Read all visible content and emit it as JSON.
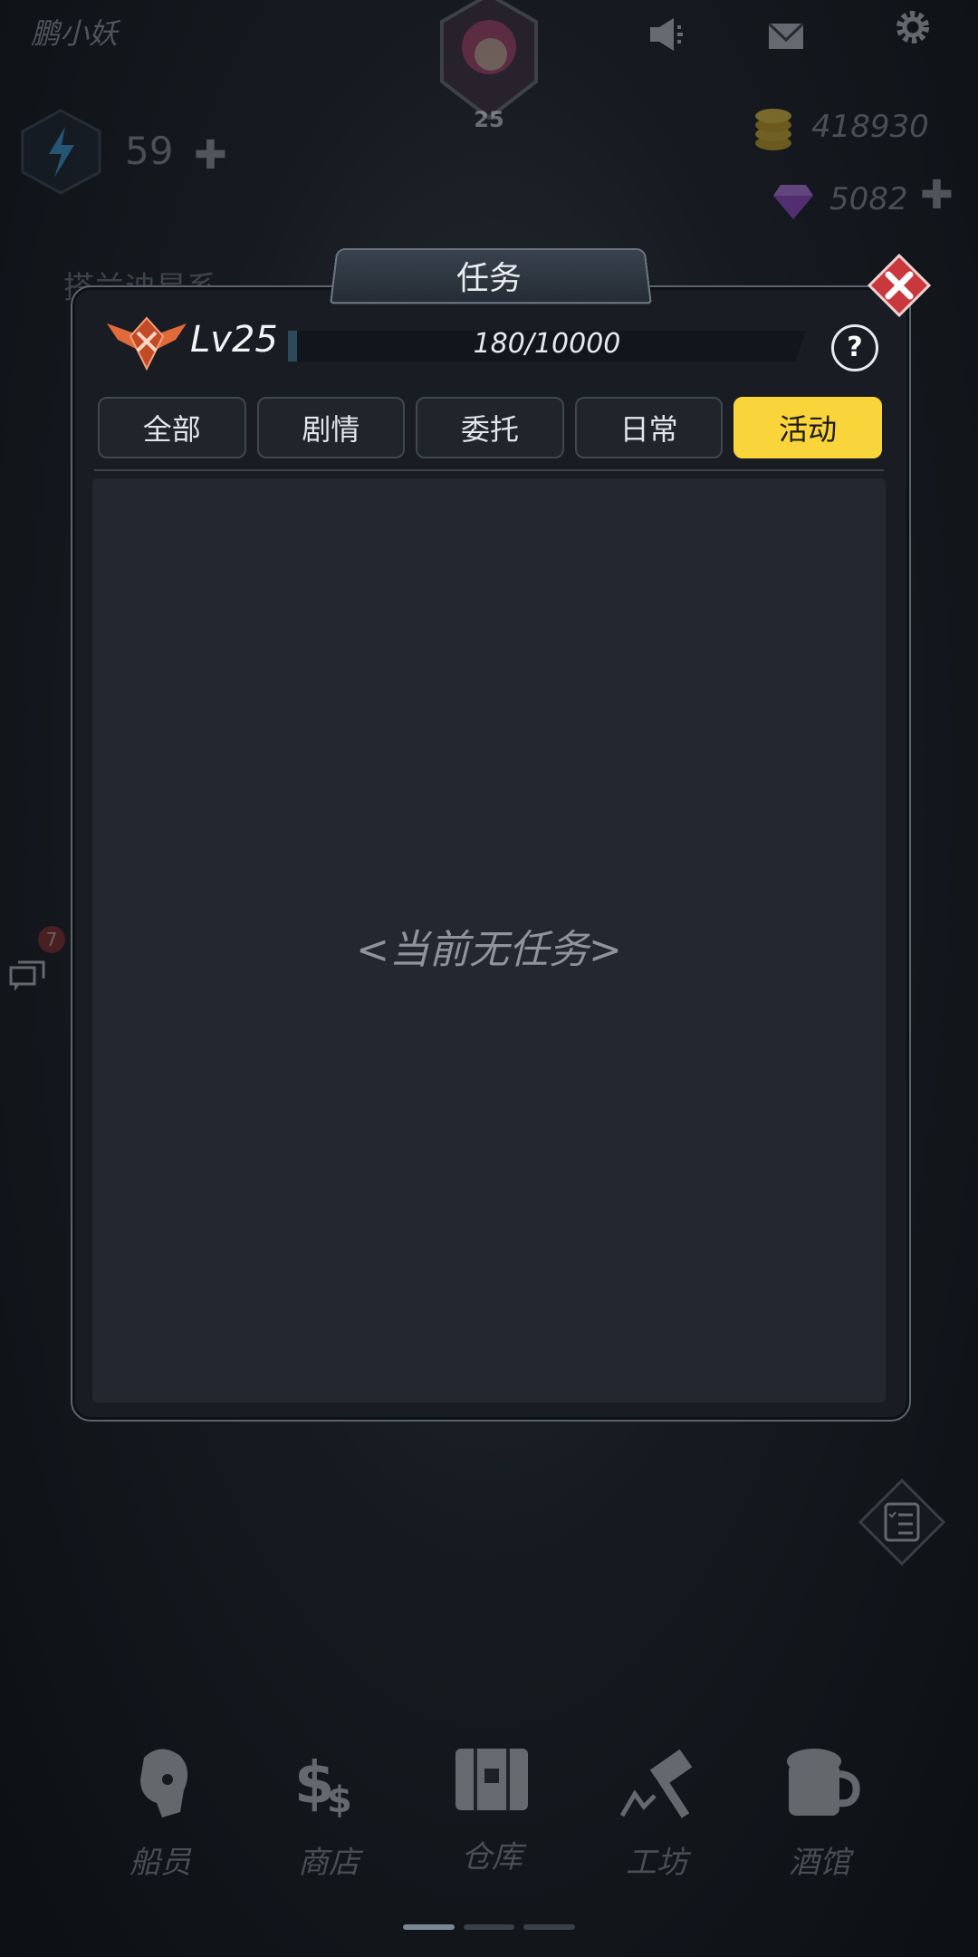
{
  "header": {
    "player_name": "鹏小妖",
    "player_level": "25",
    "energy": "59",
    "gold": "418930",
    "gems": "5082",
    "background_title": "搭兰迪星系"
  },
  "dialog": {
    "title": "任务",
    "level_label": "Lv25",
    "exp_text": "180/10000",
    "exp_fraction": 0.018,
    "help_label": "?",
    "tabs": [
      {
        "label": "全部",
        "active": false
      },
      {
        "label": "剧情",
        "active": false
      },
      {
        "label": "委托",
        "active": false
      },
      {
        "label": "日常",
        "active": false
      },
      {
        "label": "活动",
        "active": true
      }
    ],
    "empty_message": "<当前无任务>"
  },
  "side": {
    "chat_badge": "7"
  },
  "nav": {
    "items": [
      {
        "label": "船员",
        "icon": "crew-icon"
      },
      {
        "label": "商店",
        "icon": "shop-icon"
      },
      {
        "label": "仓库",
        "icon": "warehouse-icon"
      },
      {
        "label": "工坊",
        "icon": "workshop-icon"
      },
      {
        "label": "酒馆",
        "icon": "tavern-icon"
      }
    ]
  },
  "colors": {
    "accent_tab": "#f9d43a",
    "close_button": "#c8383d",
    "gold_icon": "#d4a81c",
    "gem_icon": "#9c4ad6"
  }
}
